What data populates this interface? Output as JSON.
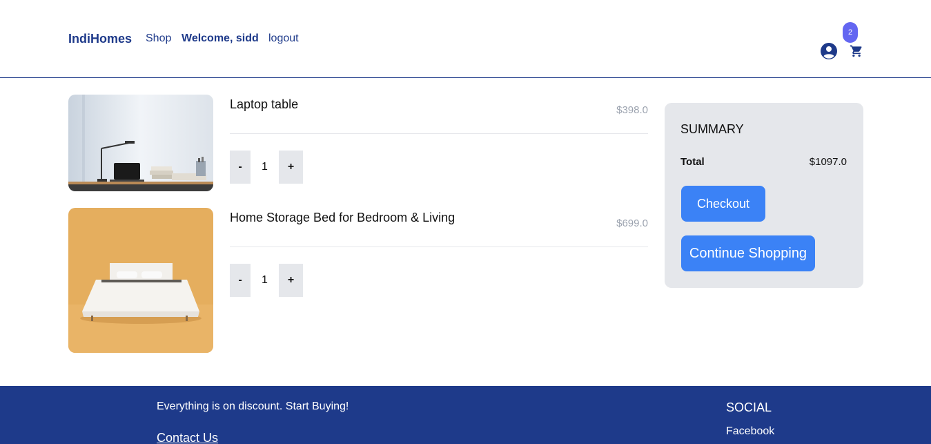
{
  "header": {
    "brand": "IndiHomes",
    "nav": {
      "shop": "Shop",
      "welcome": "Welcome, sidd",
      "logout": "logout"
    },
    "cart_count": "2",
    "icons": [
      "user-circle-icon",
      "cart-icon"
    ]
  },
  "cart": {
    "items": [
      {
        "name": "Laptop table",
        "price": "$398.0",
        "quantity": "1",
        "minus": "-",
        "plus": "+",
        "image": "laptop-table-photo"
      },
      {
        "name": "Home Storage Bed for Bedroom & Living",
        "price": "$699.0",
        "quantity": "1",
        "minus": "-",
        "plus": "+",
        "image": "bed-photo"
      }
    ]
  },
  "summary": {
    "title": "SUMMARY",
    "total_label": "Total",
    "total_value": "$1097.0",
    "checkout_label": "Checkout",
    "continue_label": "Continue Shopping"
  },
  "footer": {
    "tagline": "Everything is on discount. Start Buying!",
    "contact": "Contact Us",
    "social_title": "SOCIAL",
    "facebook": "Facebook"
  },
  "colors": {
    "primary": "#1e3a8a",
    "accent": "#3b82f6",
    "badge": "#6366f1",
    "panel": "#e5e7eb"
  }
}
